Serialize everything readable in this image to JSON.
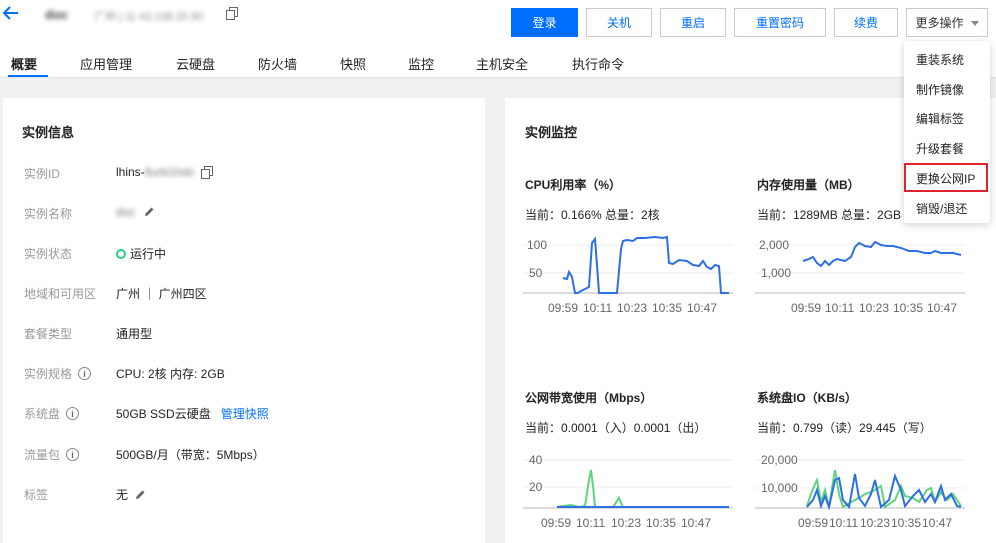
{
  "header": {
    "instance_name": "doc",
    "instance_addr": "广州 | 公 43.138.25.90",
    "buttons": {
      "login": "登录",
      "shutdown": "关机",
      "restart": "重启",
      "reset_password": "重置密码",
      "renew": "续费",
      "more": "更多操作"
    }
  },
  "tabs": [
    "概要",
    "应用管理",
    "云硬盘",
    "防火墙",
    "快照",
    "监控",
    "主机安全",
    "执行命令"
  ],
  "instance_info": {
    "title": "实例信息",
    "rows": [
      {
        "label": "实例ID",
        "value_prefix": "lhins-",
        "value_blur": "6urb1hdc"
      },
      {
        "label": "实例名称",
        "value_blur": "doc"
      },
      {
        "label": "实例状态",
        "value": "运行中"
      },
      {
        "label": "地域和可用区",
        "value": "广州 ｜ 广州四区"
      },
      {
        "label": "套餐类型",
        "value": "通用型"
      },
      {
        "label": "实例规格",
        "value": "CPU: 2核 内存: 2GB"
      },
      {
        "label": "系统盘",
        "value": "50GB SSD云硬盘",
        "link": "管理快照"
      },
      {
        "label": "流量包",
        "value": "500GB/月（带宽：5Mbps）"
      },
      {
        "label": "标签",
        "value": "无"
      }
    ]
  },
  "monitor": {
    "title": "实例监控",
    "charts": [
      {
        "title": "CPU利用率（%）",
        "current": "当前：0.166% 总量：2核",
        "ticks": [
          "100",
          "50"
        ],
        "x_labels": [
          "09:59",
          "10:11",
          "10:23",
          "10:35",
          "10:47"
        ]
      },
      {
        "title": "内存使用量（MB）",
        "current": "当前：1289MB 总量：2GB",
        "ticks": [
          "2,000",
          "1,000"
        ],
        "x_labels": [
          "09:59",
          "10:11",
          "10:23",
          "10:35",
          "10:47"
        ]
      },
      {
        "title": "公网带宽使用（Mbps）",
        "current": "当前：0.0001（入）0.0001（出）",
        "ticks": [
          "40",
          "20"
        ],
        "x_labels": [
          "09:59",
          "10:11",
          "10:23",
          "10:35",
          "10:47"
        ]
      },
      {
        "title": "系统盘IO（KB/s）",
        "current": "当前：0.799（读）29.445（写）",
        "ticks": [
          "20,000",
          "10,000"
        ],
        "x_labels": [
          "09:59",
          "10:11",
          "10:23",
          "10:35",
          "10:47"
        ]
      }
    ]
  },
  "more_menu": {
    "items": [
      "重装系统",
      "制作镜像",
      "编辑标签",
      "升级套餐",
      "更换公网IP",
      "销毁/退还"
    ],
    "highlighted": "更换公网IP"
  },
  "colors": {
    "primary": "#006eff",
    "line_blue": "#2f6fe4",
    "line_green": "#5ed37a",
    "highlight": "#e0232a",
    "status_green": "#29cc85"
  }
}
